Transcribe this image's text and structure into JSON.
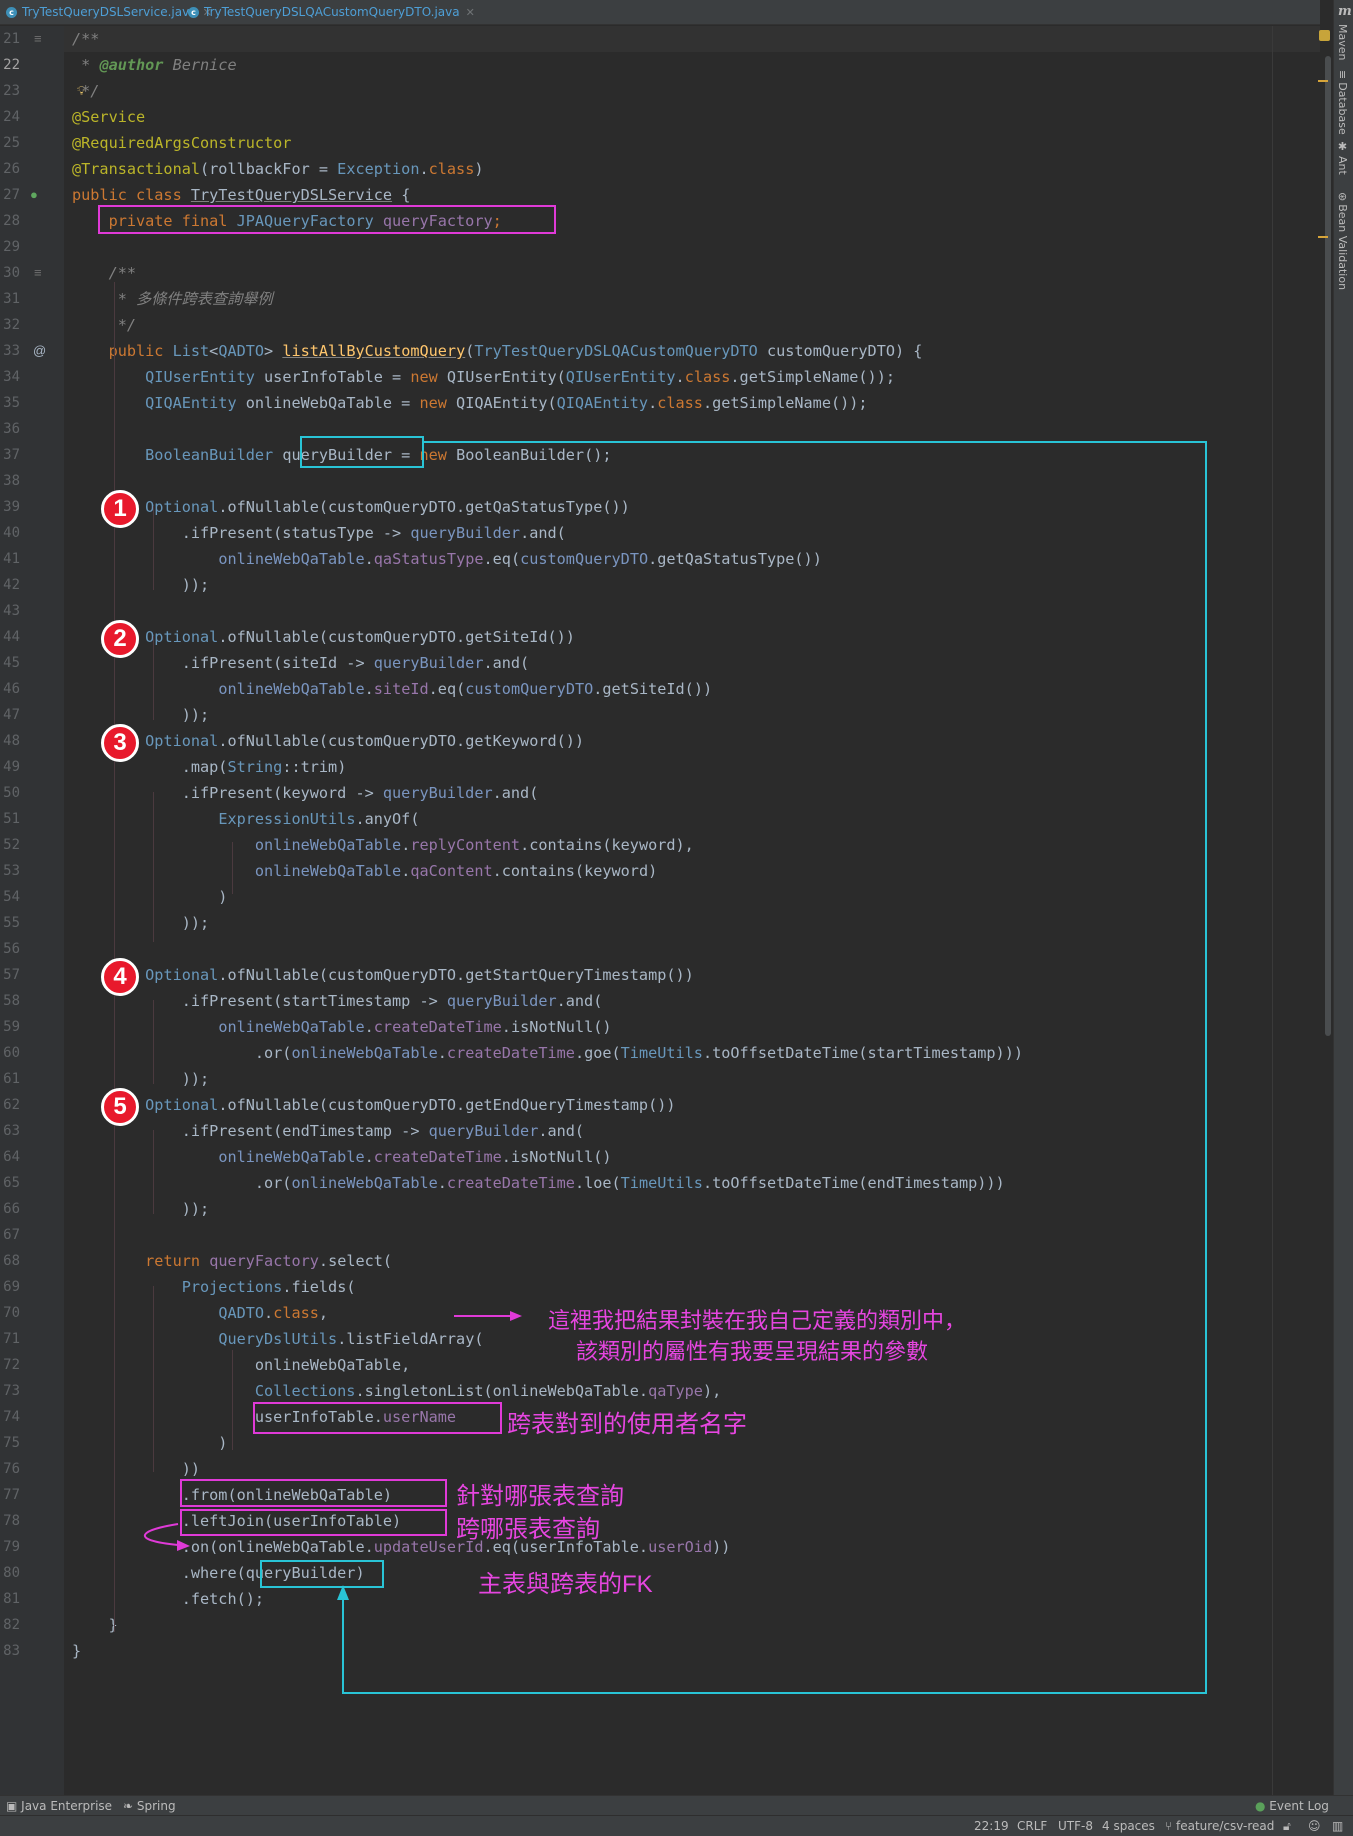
{
  "tabs": [
    {
      "label": "TryTestQueryDSLService.java"
    },
    {
      "label": "TryTestQueryDSLQACustomQueryDTO.java"
    }
  ],
  "right_tools": [
    "Maven",
    "Database",
    "Ant",
    "Bean Validation"
  ],
  "line_numbers": [
    "21",
    "22",
    "23",
    "24",
    "25",
    "26",
    "27",
    "28",
    "29",
    "30",
    "31",
    "32",
    "33",
    "34",
    "35",
    "36",
    "37",
    "38",
    "39",
    "40",
    "41",
    "42",
    "43",
    "44",
    "45",
    "46",
    "47",
    "48",
    "49",
    "50",
    "51",
    "52",
    "53",
    "54",
    "55",
    "56",
    "57",
    "58",
    "59",
    "60",
    "61",
    "62",
    "63",
    "64",
    "65",
    "66",
    "67",
    "68",
    "69",
    "70",
    "71",
    "72",
    "73",
    "74",
    "75",
    "76",
    "77",
    "78",
    "79",
    "80",
    "81",
    "82",
    "83"
  ],
  "code": {
    "l21": "/**",
    "l22a": " * ",
    "l22b": "@author",
    "l22c": " Bernice",
    "l23": " */",
    "l24": "@Service",
    "l25": "@RequiredArgsConstructor",
    "l26a": "@Transactional",
    "l26b": "(rollbackFor = ",
    "l26c": "Exception",
    "l26d": ".",
    "l26e": "class",
    "l26f": ")",
    "l27a": "public class ",
    "l27b": "TryTestQueryDSLService",
    "l27c": " {",
    "l28a": "    private final ",
    "l28b": "JPAQueryFactory",
    "l28c": " queryFactory",
    "l28d": ";",
    "l30": "    /**",
    "l31": "     * 多條件跨表查詢舉例",
    "l32": "     */",
    "l33a": "    public ",
    "l33b": "List",
    "l33c": "<",
    "l33d": "QADTO",
    "l33e": "> ",
    "l33f": "listAllByCustomQuery",
    "l33g": "(",
    "l33h": "TryTestQueryDSLQACustomQueryDTO",
    "l33i": " customQueryDTO) {",
    "l34a": "        ",
    "l34b": "QIUserEntity",
    "l34c": " userInfoTable = ",
    "l34d": "new",
    "l34e": " QIUserEntity(",
    "l34f": "QIUserEntity",
    "l34g": ".",
    "l34h": "class",
    "l34i": ".getSimpleName());",
    "l35a": "        ",
    "l35b": "QIQAEntity",
    "l35c": " onlineWebQaTable = ",
    "l35d": "new",
    "l35e": " QIQAEntity(",
    "l35f": "QIQAEntity",
    "l35g": ".",
    "l35h": "class",
    "l35i": ".getSimpleName());",
    "l37a": "        ",
    "l37b": "BooleanBuilder",
    "l37c": " queryBuilder = ",
    "l37d": "new",
    "l37e": " BooleanBuilder();",
    "l39a": "        ",
    "l39b": "Optional",
    "l39c": ".ofNullable(customQueryDTO.getQaStatusType())",
    "l40a": "            .ifPresent(statusType -> ",
    "l40b": "queryBuilder",
    "l40c": ".and(",
    "l41a": "                ",
    "l41b": "onlineWebQaTable",
    "l41c": ".",
    "l41d": "qaStatusType",
    "l41e": ".eq(",
    "l41f": "customQueryDTO",
    "l41g": ".getQaStatusType())",
    "l42": "            ));",
    "l44a": "        ",
    "l44b": "Optional",
    "l44c": ".ofNullable(customQueryDTO.getSiteId())",
    "l45a": "            .ifPresent(siteId -> ",
    "l45b": "queryBuilder",
    "l45c": ".and(",
    "l46a": "                ",
    "l46b": "onlineWebQaTable",
    "l46c": ".",
    "l46d": "siteId",
    "l46e": ".eq(",
    "l46f": "customQueryDTO",
    "l46g": ".getSiteId())",
    "l47": "            ));",
    "l48a": "        ",
    "l48b": "Optional",
    "l48c": ".ofNullable(customQueryDTO.getKeyword())",
    "l49a": "            .map(",
    "l49b": "String",
    "l49c": "::trim)",
    "l50a": "            .ifPresent(keyword -> ",
    "l50b": "queryBuilder",
    "l50c": ".and(",
    "l51a": "                ",
    "l51b": "ExpressionUtils",
    "l51c": ".anyOf(",
    "l52a": "                    ",
    "l52b": "onlineWebQaTable",
    "l52c": ".",
    "l52d": "replyContent",
    "l52e": ".contains(keyword),",
    "l53a": "                    ",
    "l53b": "onlineWebQaTable",
    "l53c": ".",
    "l53d": "qaContent",
    "l53e": ".contains(keyword)",
    "l54": "                )",
    "l55": "            ));",
    "l57a": "        ",
    "l57b": "Optional",
    "l57c": ".ofNullable(customQueryDTO.getStartQueryTimestamp())",
    "l58a": "            .ifPresent(startTimestamp -> ",
    "l58b": "queryBuilder",
    "l58c": ".and(",
    "l59a": "                ",
    "l59b": "onlineWebQaTable",
    "l59c": ".",
    "l59d": "createDateTime",
    "l59e": ".isNotNull()",
    "l60a": "                    .or(",
    "l60b": "onlineWebQaTable",
    "l60c": ".",
    "l60d": "createDateTime",
    "l60e": ".goe(",
    "l60f": "TimeUtils",
    "l60g": ".toOffsetDateTime(startTimestamp)))",
    "l61": "            ));",
    "l62a": "        ",
    "l62b": "Optional",
    "l62c": ".ofNullable(customQueryDTO.getEndQueryTimestamp())",
    "l63a": "            .ifPresent(endTimestamp -> ",
    "l63b": "queryBuilder",
    "l63c": ".and(",
    "l64a": "                ",
    "l64b": "onlineWebQaTable",
    "l64c": ".",
    "l64d": "createDateTime",
    "l64e": ".isNotNull()",
    "l65a": "                    .or(",
    "l65b": "onlineWebQaTable",
    "l65c": ".",
    "l65d": "createDateTime",
    "l65e": ".loe(",
    "l65f": "TimeUtils",
    "l65g": ".toOffsetDateTime(endTimestamp)))",
    "l66": "            ));",
    "l68a": "        ",
    "l68b": "return",
    "l68c": " ",
    "l68d": "queryFactory",
    "l68e": ".select(",
    "l69a": "            ",
    "l69b": "Projections",
    "l69c": ".fields(",
    "l70a": "                ",
    "l70b": "QADTO",
    "l70c": ".",
    "l70d": "class",
    "l70e": ",",
    "l71a": "                ",
    "l71b": "QueryDslUtils",
    "l71c": ".listFieldArray(",
    "l72": "                    onlineWebQaTable,",
    "l73a": "                    ",
    "l73b": "Collections",
    "l73c": ".singletonList(onlineWebQaTable.",
    "l73d": "qaType",
    "l73e": "),",
    "l74a": "                    userInfoTable.",
    "l74b": "userName",
    "l75": "                )",
    "l76": "            ))",
    "l77": "            .from(onlineWebQaTable)",
    "l78": "            .leftJoin(userInfoTable)",
    "l79a": "            .on(onlineWebQaTable.",
    "l79b": "updateUserId",
    "l79c": ".eq(userInfoTable.",
    "l79d": "userOid",
    "l79e": "))",
    "l80": "            .where(queryBuilder)",
    "l81": "            .fetch();",
    "l82": "    }",
    "l83": "}"
  },
  "badges": [
    "1",
    "2",
    "3",
    "4",
    "5"
  ],
  "notes": {
    "n1a": "這裡我把結果封裝在我自己定義的類別中，",
    "n1b": "該類別的屬性有我要呈現結果的參數",
    "n2": "跨表對到的使用者名字",
    "n3": "針對哪張表查詢",
    "n4": "跨哪張表查詢",
    "n5": "主表與跨表的FK"
  },
  "bottom_tools": {
    "left1": "Java Enterprise",
    "left2": "Spring",
    "right": "Event Log"
  },
  "status": {
    "pos": "22:19",
    "eol": "CRLF",
    "enc": "UTF-8",
    "indent": "4 spaces",
    "branch": "feature/csv-read"
  },
  "colors": {
    "annotation_magenta": "#e03ad8",
    "annotation_cyan": "#29c4d6",
    "badge_red": "#e8192c"
  }
}
